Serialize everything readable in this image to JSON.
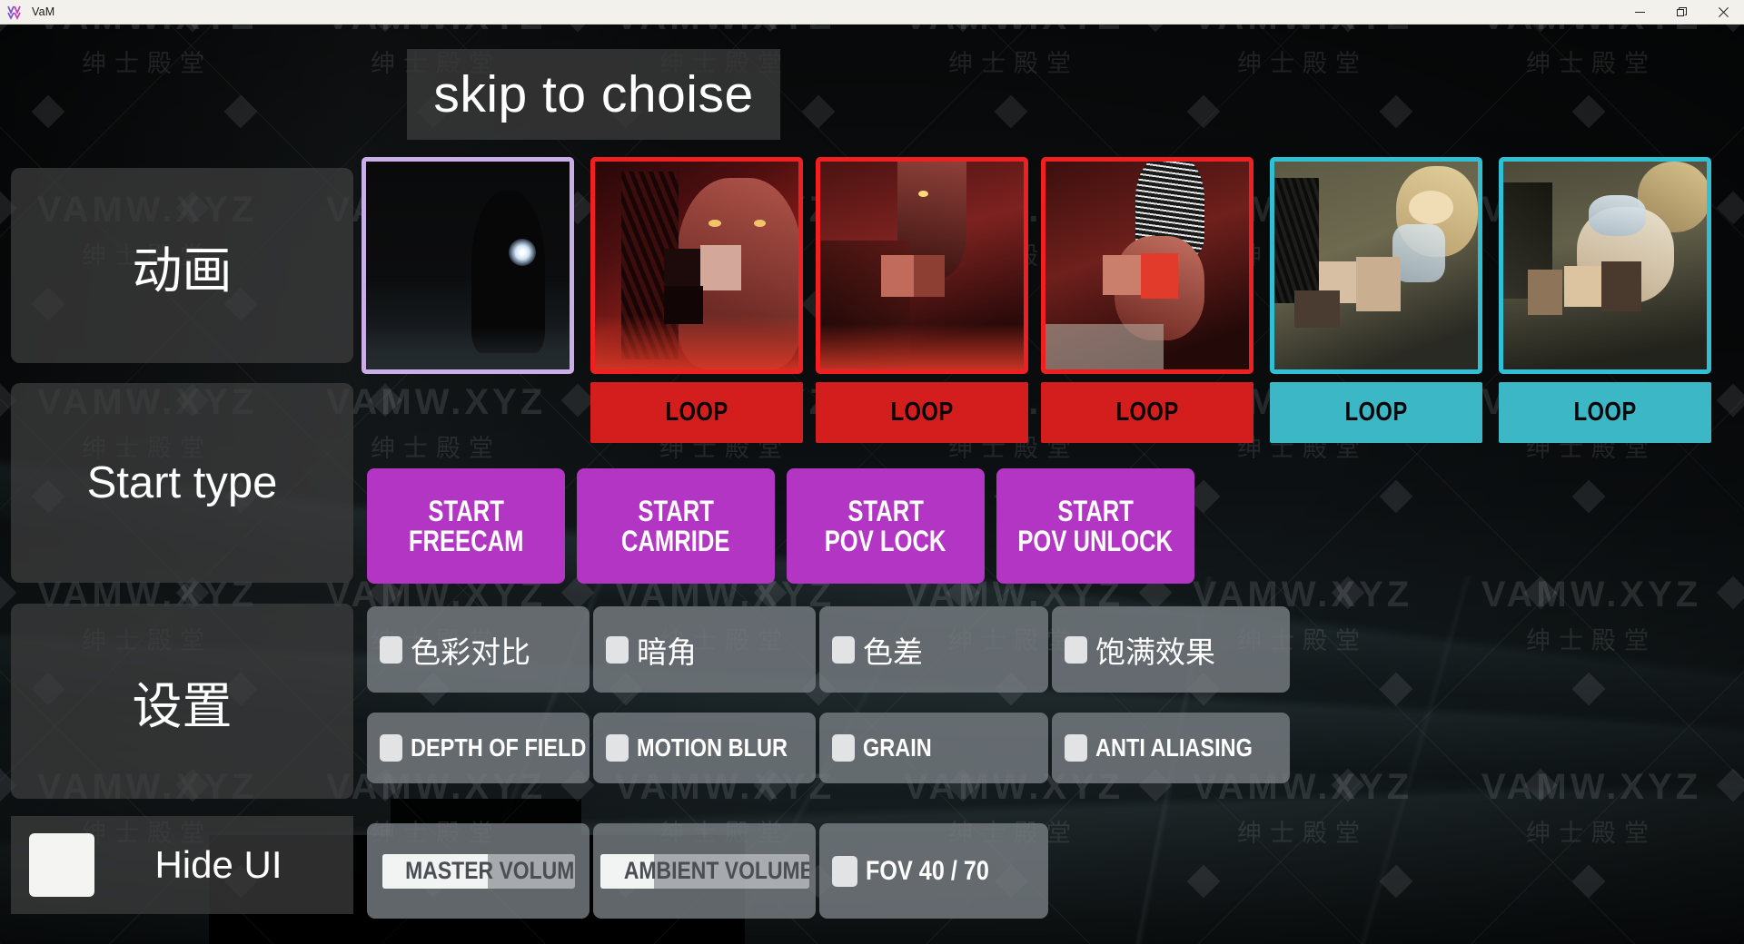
{
  "window": {
    "app_title": "VaM",
    "logo_icon": "vam-logo-icon",
    "controls": {
      "minimize": "minimize-icon",
      "restore": "restore-icon",
      "close": "close-icon"
    }
  },
  "header": {
    "skip_label": "skip to choise"
  },
  "sidebar": {
    "items": [
      {
        "label": "动画",
        "name": "animation"
      },
      {
        "label": "Start type",
        "name": "start-type"
      },
      {
        "label": "设置",
        "name": "settings"
      }
    ],
    "hide_ui": {
      "label": "Hide UI",
      "checked": false
    }
  },
  "animations": {
    "loop_label": "LOOP",
    "items": [
      {
        "index": 1,
        "border_color": "#c9aee8",
        "has_loop": false,
        "loop_color": "",
        "scene": "dark-figure-orb"
      },
      {
        "index": 2,
        "border_color": "#f02020",
        "has_loop": true,
        "loop_color": "#d41d1d",
        "scene": "red-demon-face"
      },
      {
        "index": 3,
        "border_color": "#f02020",
        "has_loop": true,
        "loop_color": "#d41d1d",
        "scene": "red-scene-b"
      },
      {
        "index": 4,
        "border_color": "#f02020",
        "has_loop": true,
        "loop_color": "#d41d1d",
        "scene": "red-scene-c"
      },
      {
        "index": 5,
        "border_color": "#2fc0d6",
        "has_loop": true,
        "loop_color": "#3bb7c6",
        "scene": "teal-scene-a"
      },
      {
        "index": 6,
        "border_color": "#2fc0d6",
        "has_loop": true,
        "loop_color": "#3bb7c6",
        "scene": "teal-scene-b"
      }
    ]
  },
  "start_buttons": {
    "color": "#b235c4",
    "items": [
      {
        "line1": "START",
        "line2": "FREECAM",
        "name": "freecam"
      },
      {
        "line1": "START",
        "line2": "CAMRIDE",
        "name": "camride"
      },
      {
        "line1": "START",
        "line2": "POV LOCK",
        "name": "pov-lock"
      },
      {
        "line1": "START",
        "line2": "POV UNLOCK",
        "name": "pov-unlock"
      }
    ]
  },
  "settings": {
    "row1": [
      {
        "label": "色彩对比",
        "name": "color-contrast",
        "checked": false
      },
      {
        "label": "暗角",
        "name": "vignette",
        "checked": false
      },
      {
        "label": "色差",
        "name": "chromatic-aberration",
        "checked": false
      },
      {
        "label": "饱满效果",
        "name": "bloom",
        "checked": false
      }
    ],
    "row2": [
      {
        "label": "DEPTH OF FIELD",
        "name": "depth-of-field",
        "checked": false
      },
      {
        "label": "MOTION BLUR",
        "name": "motion-blur",
        "checked": false
      },
      {
        "label": "GRAIN",
        "name": "grain",
        "checked": false
      },
      {
        "label": "ANTI ALIASING",
        "name": "anti-aliasing",
        "checked": false
      }
    ],
    "row3": {
      "master_volume": {
        "label": "MASTER VOLUME",
        "fill_percent": 55
      },
      "ambient_volume": {
        "label": "AMBIENT VOLUME",
        "fill_percent": 26
      },
      "fov": {
        "label": "FOV 40 / 70",
        "checked": false
      }
    }
  },
  "watermark": {
    "main": "VAMW.XYZ",
    "sub": "绅士殿堂"
  }
}
